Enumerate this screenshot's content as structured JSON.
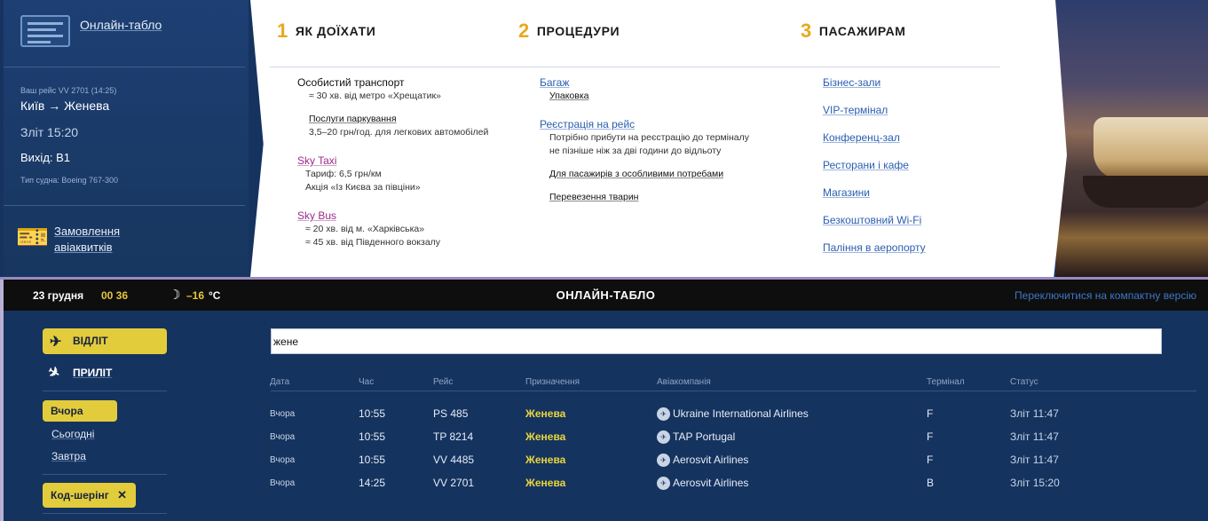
{
  "left_panel": {
    "online_board_link": "Онлайн-табло",
    "your_flight": "Ваш рейс VV 2701 (14:25)",
    "route": "Київ → Женева",
    "departure": "Зліт 15:20",
    "gate": "Вихід: B1",
    "aircraft": "Тип судна: Boeing 767-300",
    "tickets_line1": "Замовлення",
    "tickets_line2": "авіаквитків"
  },
  "menu": {
    "col1": {
      "num": "1",
      "title": "ЯК ДОЇХАТИ",
      "private_transport": "Особистий транспорт",
      "private_sub": "≈ 30 хв. від метро «Хрещатик»",
      "parking": "Послуги паркування",
      "parking_sub": "3,5–20 грн/год. для легкових автомобілей",
      "sky_taxi": "Sky Taxi",
      "sky_taxi_sub1": "Тариф: 6,5 грн/км",
      "sky_taxi_sub2": "Акція «Із Києва за півціни»",
      "sky_bus": "Sky Bus",
      "sky_bus_sub1": "≈ 20 хв. від м. «Харківська»",
      "sky_bus_sub2": "≈ 45 хв. від Південного вокзалу"
    },
    "col2": {
      "num": "2",
      "title": "ПРОЦЕДУРИ",
      "baggage": "Багаж",
      "packing": "Упаковка",
      "checkin": "Реєстрація на рейс",
      "checkin_sub1": "Потрібно прибути на реєстрацію до терміналу",
      "checkin_sub2": "не пізніше ніж за дві години до відльоту",
      "special_needs": "Для пасажирів з особливими потребами",
      "animals": "Перевезення тварин"
    },
    "col3": {
      "num": "3",
      "title": "ПАСАЖИРАМ",
      "links": [
        "Бізнес-зали",
        "VIP-термінал",
        "Конференц-зал",
        "Ресторани і кафе",
        "Магазини",
        "Безкоштовний Wi-Fi",
        "Паління в аеропорту"
      ]
    }
  },
  "board": {
    "date": "23 грудня",
    "time": "00 36",
    "temp": "–16",
    "temp_unit": "°C",
    "title": "ОНЛАЙН-ТАБЛО",
    "compact_link": "Переключитися на компактну версію",
    "departure_btn": "ВІДЛІТ",
    "arrival_btn": "ПРИЛІТ",
    "yesterday": "Вчора",
    "today": "Сьогодні",
    "tomorrow": "Завтра",
    "codeshare": "Код-шерінг",
    "search_value": "жене",
    "headers": [
      "Дата",
      "Час",
      "Рейс",
      "Призначення",
      "Авіакомпанія",
      "Термінал",
      "Статус"
    ],
    "rows": [
      {
        "date": "Вчора",
        "time": "10:55",
        "flight": "PS 485",
        "dest": "Женева",
        "airline": "Ukraine International Airlines",
        "terminal": "F",
        "status": "Зліт 11:47"
      },
      {
        "date": "Вчора",
        "time": "10:55",
        "flight": "TP 8214",
        "dest": "Женева",
        "airline": "TAP Portugal",
        "terminal": "F",
        "status": "Зліт 11:47"
      },
      {
        "date": "Вчора",
        "time": "10:55",
        "flight": "VV 4485",
        "dest": "Женева",
        "airline": "Aerosvit Airlines",
        "terminal": "F",
        "status": "Зліт 11:47"
      },
      {
        "date": "Вчора",
        "time": "14:25",
        "flight": "VV 2701",
        "dest": "Женева",
        "airline": "Aerosvit Airlines",
        "terminal": "B",
        "status": "Зліт 15:20"
      }
    ]
  }
}
